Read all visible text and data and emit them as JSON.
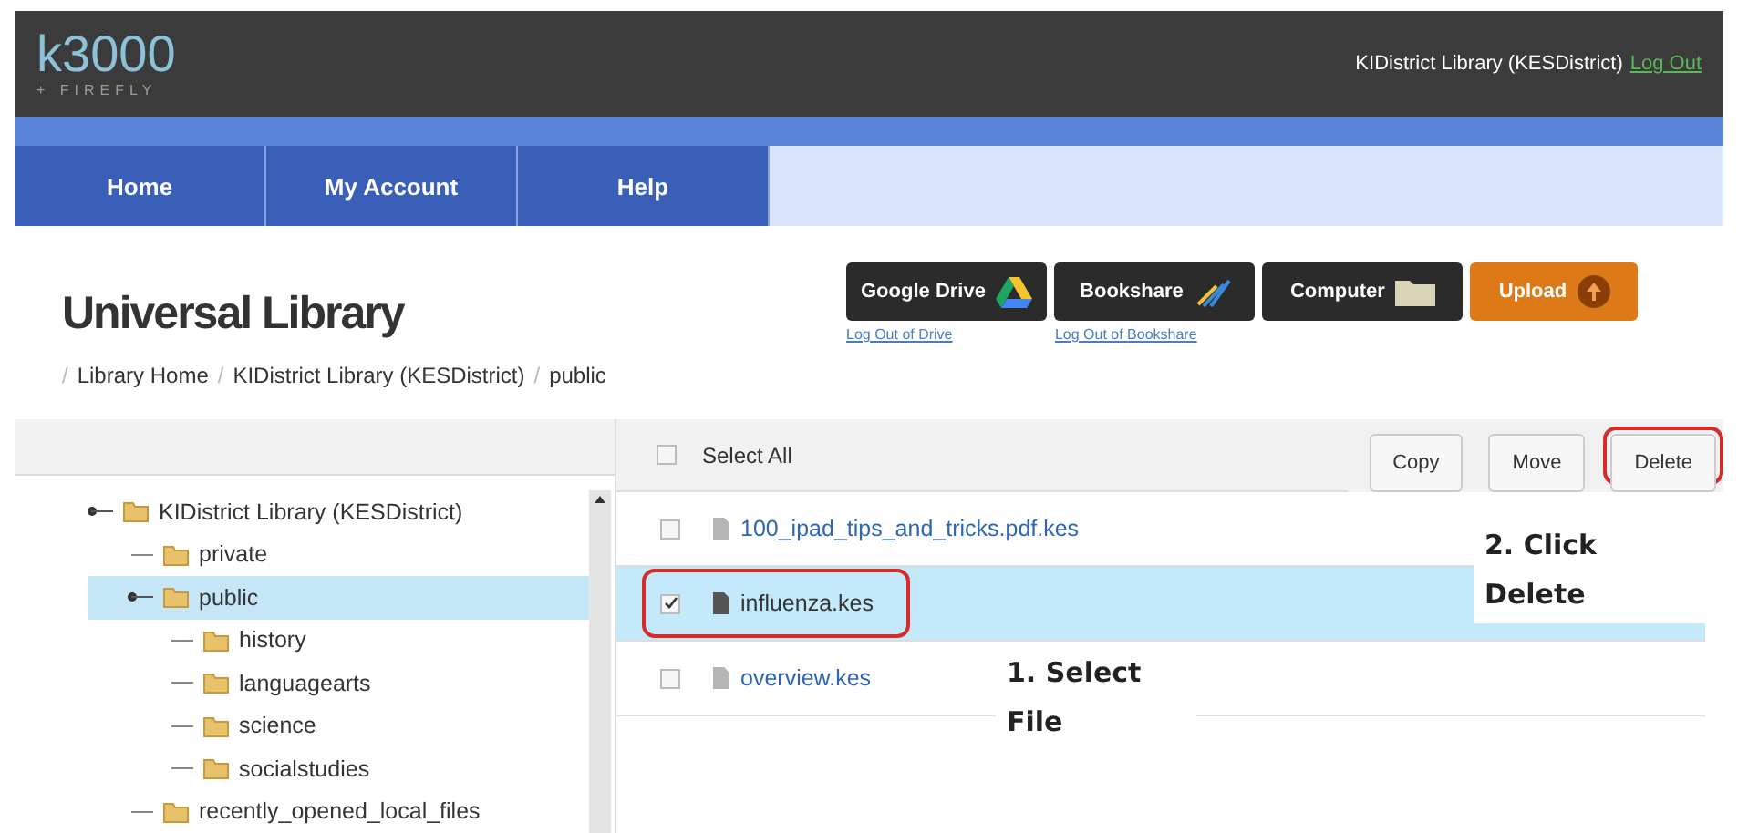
{
  "header": {
    "logo": "k3000",
    "logo_tagline": "+ FIREFLY",
    "account": "KIDistrict Library (KESDistrict)",
    "logout": "Log Out"
  },
  "nav": [
    {
      "label": "Home",
      "selected": false
    },
    {
      "label": "My Account",
      "selected": false
    },
    {
      "label": "Help",
      "selected": false
    }
  ],
  "page_title": "Universal Library",
  "breadcrumb": [
    {
      "separator": "/",
      "label": "Library Home"
    },
    {
      "separator": "/",
      "label": "KIDistrict Library (KESDistrict)"
    },
    {
      "separator": "/",
      "label": "public"
    }
  ],
  "sources": [
    {
      "label": "Google Drive",
      "kind": "drive",
      "link": "Log Out of Drive"
    },
    {
      "label": "Bookshare",
      "kind": "bookshare",
      "link": "Log Out of Bookshare"
    },
    {
      "label": "Computer",
      "kind": "computer"
    },
    {
      "label": "Upload",
      "kind": "upload"
    }
  ],
  "select_all": {
    "label": "Select All",
    "checked": false
  },
  "actions": [
    {
      "label": "Copy",
      "annotated": false
    },
    {
      "label": "Move",
      "annotated": false
    },
    {
      "label": "Delete",
      "annotated": true
    }
  ],
  "tree": [
    {
      "label": "KIDistrict Library (KESDistrict)",
      "selected": false,
      "expanded": true,
      "children": [
        {
          "label": "private",
          "selected": false,
          "expanded": false
        },
        {
          "label": "public",
          "selected": true,
          "expanded": true,
          "children": [
            {
              "label": "history",
              "selected": false,
              "expanded": false
            },
            {
              "label": "languagearts",
              "selected": false,
              "expanded": false
            },
            {
              "label": "science",
              "selected": false,
              "expanded": false
            },
            {
              "label": "socialstudies",
              "selected": false,
              "expanded": false
            }
          ]
        },
        {
          "label": "recently_opened_local_files",
          "selected": false,
          "expanded": false
        }
      ]
    }
  ],
  "files": [
    {
      "name": "100_ipad_tips_and_tricks.pdf.kes",
      "checked": false,
      "selected": false,
      "annotated": false
    },
    {
      "name": "influenza.kes",
      "checked": true,
      "selected": true,
      "annotated": true
    },
    {
      "name": "overview.kes",
      "checked": false,
      "selected": false,
      "annotated": false
    }
  ],
  "callouts": [
    "2. Click\nDelete",
    "1. Select\nFile"
  ]
}
